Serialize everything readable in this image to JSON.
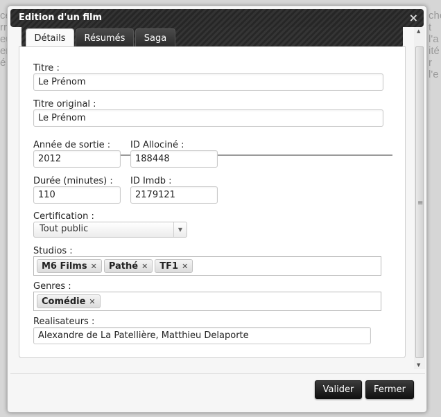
{
  "background": {
    "left_text": [
      "ce",
      "rr",
      "eu",
      "er",
      "é"
    ],
    "right_text": [
      "che",
      "t l'a",
      "ité",
      "r l'e"
    ]
  },
  "dialog": {
    "title": "Edition d'un film",
    "close_glyph": "×"
  },
  "tabs": [
    {
      "label": "Détails",
      "active": true
    },
    {
      "label": "Résumés",
      "active": false
    },
    {
      "label": "Saga",
      "active": false
    }
  ],
  "form": {
    "titre": {
      "label": "Titre :",
      "value": "Le Prénom"
    },
    "titre_original": {
      "label": "Titre original :",
      "value": "Le Prénom"
    },
    "annee": {
      "label": "Année de sortie :",
      "value": "2012"
    },
    "allocine": {
      "label": "ID Allociné :",
      "value": "188448"
    },
    "duree": {
      "label": "Durée (minutes) :",
      "value": "110"
    },
    "imdb": {
      "label": "ID Imdb :",
      "value": "2179121"
    },
    "certification": {
      "label": "Certification :",
      "value": "Tout public"
    },
    "studios": {
      "label": "Studios :",
      "tags": [
        "M6 Films",
        "Pathé",
        "TF1"
      ]
    },
    "genres": {
      "label": "Genres :",
      "tags": [
        "Comédie"
      ]
    },
    "realisateurs": {
      "label": "Realisateurs :",
      "value": "Alexandre de La Patellière, Matthieu Delaporte"
    }
  },
  "buttons": {
    "validate": "Valider",
    "close": "Fermer"
  }
}
